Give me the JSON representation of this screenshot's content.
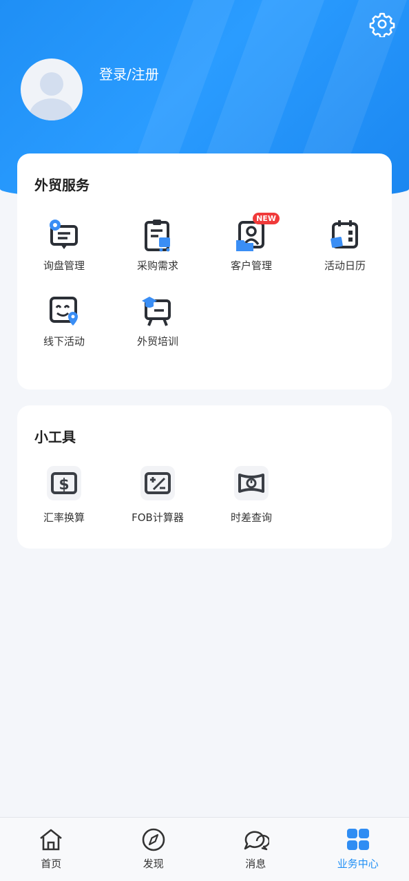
{
  "header": {
    "login_label": "登录/注册"
  },
  "trade_services": {
    "title": "外贸服务",
    "items": [
      {
        "label": "询盘管理",
        "icon": "inquiry-icon"
      },
      {
        "label": "采购需求",
        "icon": "purchase-icon"
      },
      {
        "label": "客户管理",
        "icon": "customer-icon",
        "badge": "NEW"
      },
      {
        "label": "活动日历",
        "icon": "calendar-icon"
      },
      {
        "label": "线下活动",
        "icon": "offline-event-icon"
      },
      {
        "label": "外贸培训",
        "icon": "training-icon"
      }
    ]
  },
  "tools": {
    "title": "小工具",
    "items": [
      {
        "label": "汇率换算",
        "icon": "currency-icon"
      },
      {
        "label": "FOB计算器",
        "icon": "calculator-icon"
      },
      {
        "label": "时差查询",
        "icon": "time-zone-icon"
      }
    ]
  },
  "tabbar": {
    "tabs": [
      {
        "label": "首页",
        "icon": "home-icon"
      },
      {
        "label": "发现",
        "icon": "compass-icon"
      },
      {
        "label": "消息",
        "icon": "chat-icon"
      },
      {
        "label": "业务中心",
        "icon": "grid-icon",
        "active": true
      }
    ]
  },
  "colors": {
    "accent": "#1f8ff5",
    "badge": "#f03a3a",
    "icon_dark": "#2b2f36"
  }
}
